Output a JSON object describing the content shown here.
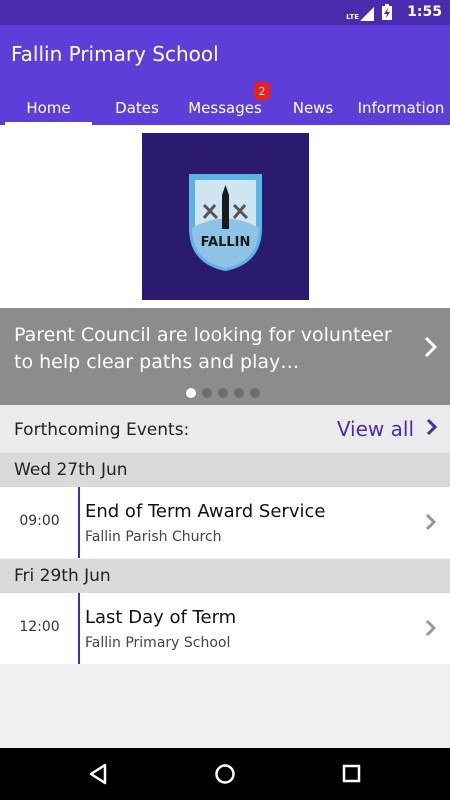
{
  "status_bar": {
    "time": "1:55",
    "network": "LTE",
    "battery_icon": "battery-charging-icon",
    "signal_icon": "signal-icon"
  },
  "app": {
    "title": "Fallin Primary School",
    "brand_color": "#5e3ed9",
    "accent_color": "#4a2aad"
  },
  "tabs": [
    {
      "label": "Home",
      "selected": true
    },
    {
      "label": "Dates",
      "selected": false
    },
    {
      "label": "Messages",
      "selected": false,
      "badge": "2"
    },
    {
      "label": "News",
      "selected": false
    },
    {
      "label": "Information",
      "selected": false
    }
  ],
  "logo": {
    "badge_text": "FALLIN"
  },
  "carousel": {
    "text": "Parent Council are looking for volunteer to help clear paths and play…",
    "slide_count": 5,
    "active_slide": 1
  },
  "events": {
    "title": "Forthcoming Events:",
    "view_all": "View all",
    "days": [
      {
        "date": "Wed 27th Jun",
        "items": [
          {
            "time": "09:00",
            "title": "End of Term Award Service",
            "location": "Fallin Parish Church"
          }
        ]
      },
      {
        "date": "Fri 29th Jun",
        "items": [
          {
            "time": "12:00",
            "title": "Last Day of Term",
            "location": "Fallin Primary School"
          }
        ]
      }
    ]
  },
  "nav_bar": {
    "back": "back-icon",
    "home": "home-icon",
    "recents": "recents-icon"
  }
}
